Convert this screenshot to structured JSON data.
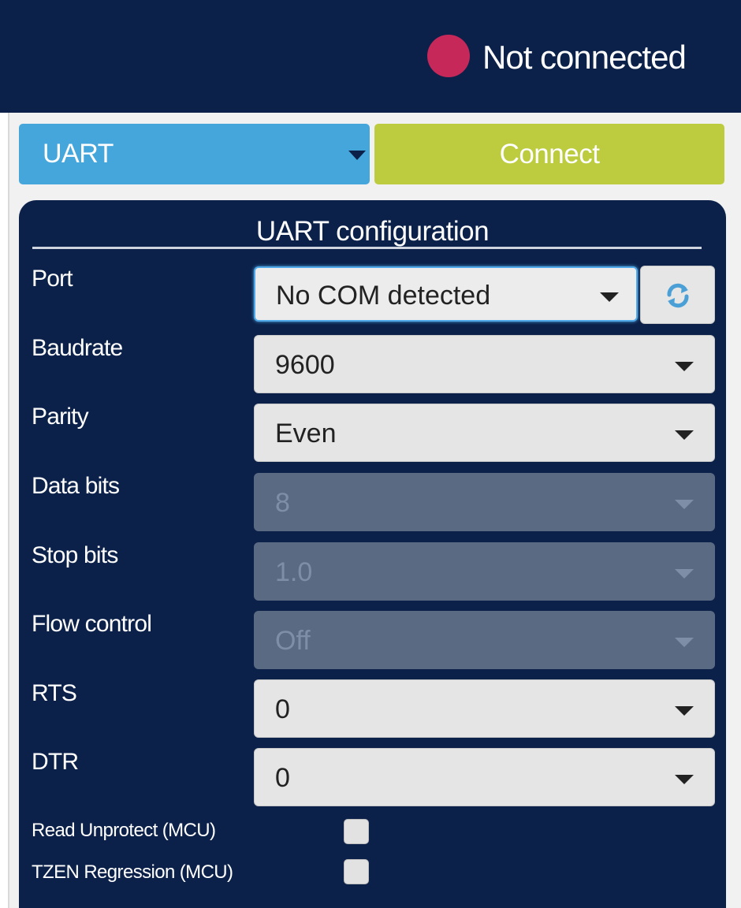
{
  "status": {
    "text": "Not connected",
    "color": "#c6285a"
  },
  "mode_select": {
    "value": "UART"
  },
  "connect_button": {
    "label": "Connect"
  },
  "config": {
    "title": "UART configuration",
    "port": {
      "label": "Port",
      "value": "No COM detected",
      "refresh_icon": "refresh-icon"
    },
    "baudrate": {
      "label": "Baudrate",
      "value": "9600"
    },
    "parity": {
      "label": "Parity",
      "value": "Even"
    },
    "data_bits": {
      "label": "Data bits",
      "value": "8",
      "disabled": true
    },
    "stop_bits": {
      "label": "Stop bits",
      "value": "1.0",
      "disabled": true
    },
    "flow_control": {
      "label": "Flow control",
      "value": "Off",
      "disabled": true
    },
    "rts": {
      "label": "RTS",
      "value": "0"
    },
    "dtr": {
      "label": "DTR",
      "value": "0"
    },
    "read_unprotect": {
      "label": "Read Unprotect (MCU)",
      "checked": false
    },
    "tzen_regression": {
      "label": "TZEN Regression (MCU)",
      "checked": false
    }
  },
  "colors": {
    "header_bg": "#0b2149",
    "mode_select_bg": "#45a6dc",
    "connect_bg": "#bccc3e",
    "panel_bg": "#0b2149"
  }
}
